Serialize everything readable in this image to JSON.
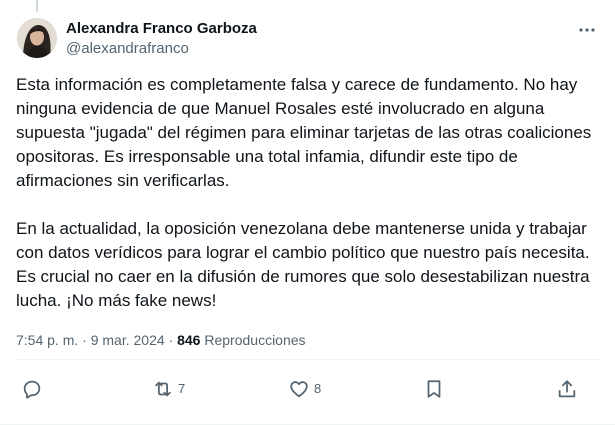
{
  "author": {
    "display_name": "Alexandra Franco Garboza",
    "handle": "@alexandrafranco"
  },
  "post": {
    "paragraphs": [
      "Esta información es completamente falsa y carece de fundamento. No hay ninguna evidencia de que Manuel Rosales esté involucrado en alguna supuesta \"jugada\" del régimen para eliminar tarjetas de las otras coaliciones opositoras. Es irresponsable una total infamia, difundir este tipo de afirmaciones sin verificarlas.",
      "En la actualidad, la oposición venezolana debe mantenerse unida y trabajar con datos verídicos para lograr el cambio político que nuestro país necesita. Es crucial no caer en la difusión de rumores que solo desestabilizan nuestra lucha. ¡No más fake news!"
    ]
  },
  "meta": {
    "time": "7:54 p. m.",
    "separator": "·",
    "date": "9 mar. 2024",
    "views_count": "846",
    "views_label": "Reproducciones"
  },
  "actions": {
    "reply": {
      "icon": "reply-icon",
      "count": ""
    },
    "repost": {
      "icon": "repost-icon",
      "count": "7"
    },
    "like": {
      "icon": "heart-icon",
      "count": "8"
    },
    "bookmark": {
      "icon": "bookmark-icon",
      "count": ""
    },
    "share": {
      "icon": "share-icon",
      "count": ""
    }
  },
  "icons": {
    "more": "more-horizontal-icon"
  },
  "colors": {
    "text_primary": "#0f1419",
    "text_secondary": "#536471",
    "divider": "#eff3f4"
  }
}
